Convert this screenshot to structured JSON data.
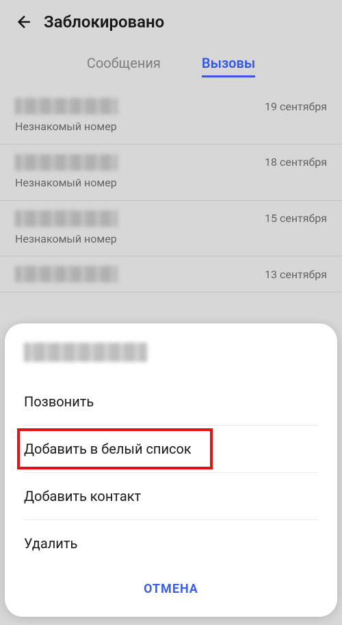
{
  "header": {
    "title": "Заблокировано"
  },
  "tabs": {
    "messages": "Сообщения",
    "calls": "Вызовы"
  },
  "list": {
    "sub_label": "Незнакомый номер",
    "items": [
      {
        "date": "19 сентября"
      },
      {
        "date": "18 сентября"
      },
      {
        "date": "15 сентября"
      },
      {
        "date": "13 сентября"
      }
    ]
  },
  "sheet": {
    "call": "Позвонить",
    "whitelist": "Добавить в белый список",
    "add_contact": "Добавить контакт",
    "delete": "Удалить",
    "cancel": "ОТМЕНА"
  }
}
